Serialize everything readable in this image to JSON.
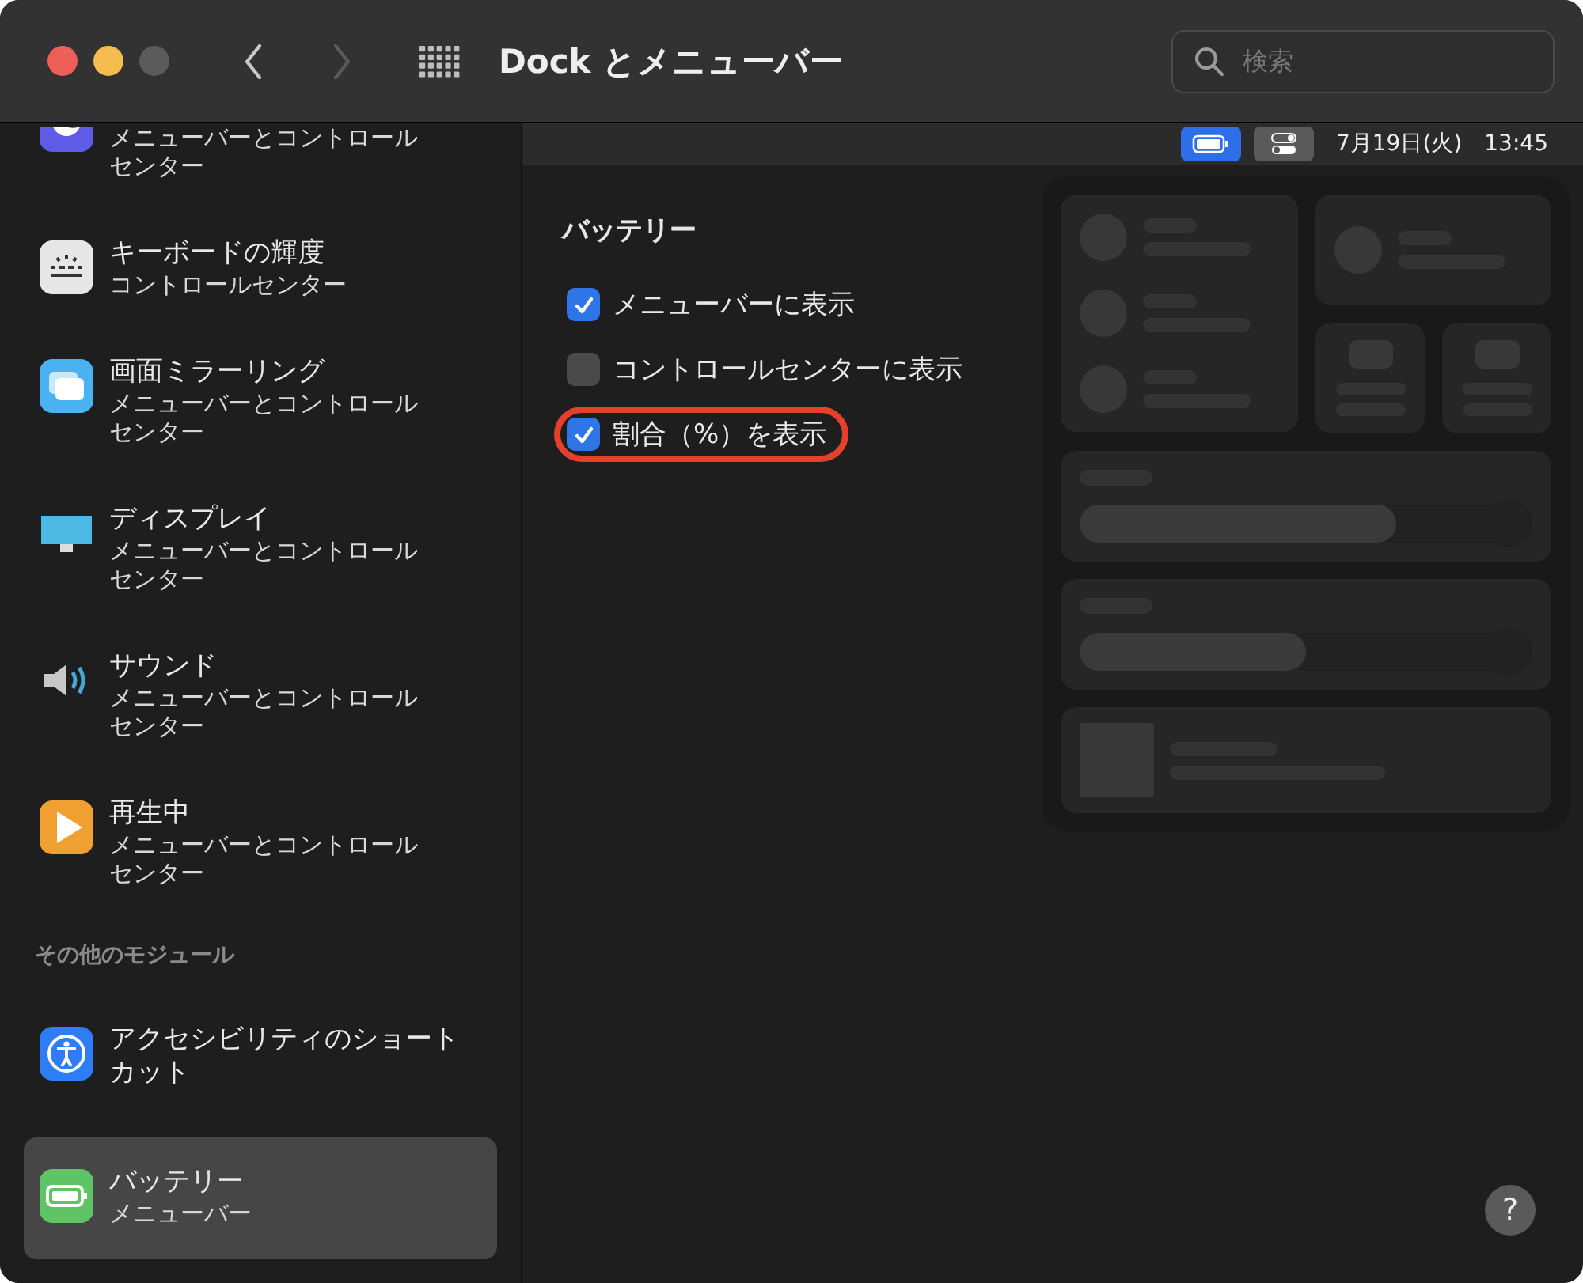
{
  "window": {
    "title": "Dock とメニューバー",
    "nav": [
      {
        "kind": "back",
        "disabled": false
      },
      {
        "kind": "forward",
        "disabled": true
      }
    ]
  },
  "search": {
    "placeholder": "検索"
  },
  "sidebar": {
    "items": [
      {
        "kind": "moon",
        "subtitle": "メニューバーとコントロールセンター",
        "selected": false
      },
      {
        "kind": "keyboard",
        "title": "キーボードの輝度",
        "subtitle": "コントロールセンター",
        "selected": false
      },
      {
        "kind": "mirror",
        "title": "画面ミラーリング",
        "subtitle": "メニューバーとコントロールセンター",
        "selected": false
      },
      {
        "kind": "display",
        "title": "ディスプレイ",
        "subtitle": "メニューバーとコントロールセンター",
        "selected": false
      },
      {
        "kind": "sound",
        "title": "サウンド",
        "subtitle": "メニューバーとコントロールセンター",
        "selected": false
      },
      {
        "kind": "play",
        "title": "再生中",
        "subtitle": "メニューバーとコントロールセンター",
        "selected": false
      },
      {
        "kind": "header",
        "title": "その他のモジュール"
      },
      {
        "kind": "accessibility",
        "title": "アクセシビリティのショートカット",
        "selected": false
      },
      {
        "kind": "battery",
        "title": "バッテリー",
        "subtitle": "メニューバー",
        "selected": true
      }
    ]
  },
  "menubar": {
    "items": [
      {
        "kind": "battery",
        "selected": true
      },
      {
        "kind": "control-center",
        "selected": false
      }
    ],
    "date": "7月19日(火)",
    "time": "13:45"
  },
  "section": {
    "title": "バッテリー",
    "options": [
      {
        "label": "メニューバーに表示",
        "checked": true,
        "highlighted": false
      },
      {
        "label": "コントロールセンターに表示",
        "checked": false,
        "highlighted": false
      },
      {
        "label": "割合（%）を表示",
        "checked": true,
        "highlighted": true
      }
    ]
  },
  "help": {
    "label": "?"
  }
}
